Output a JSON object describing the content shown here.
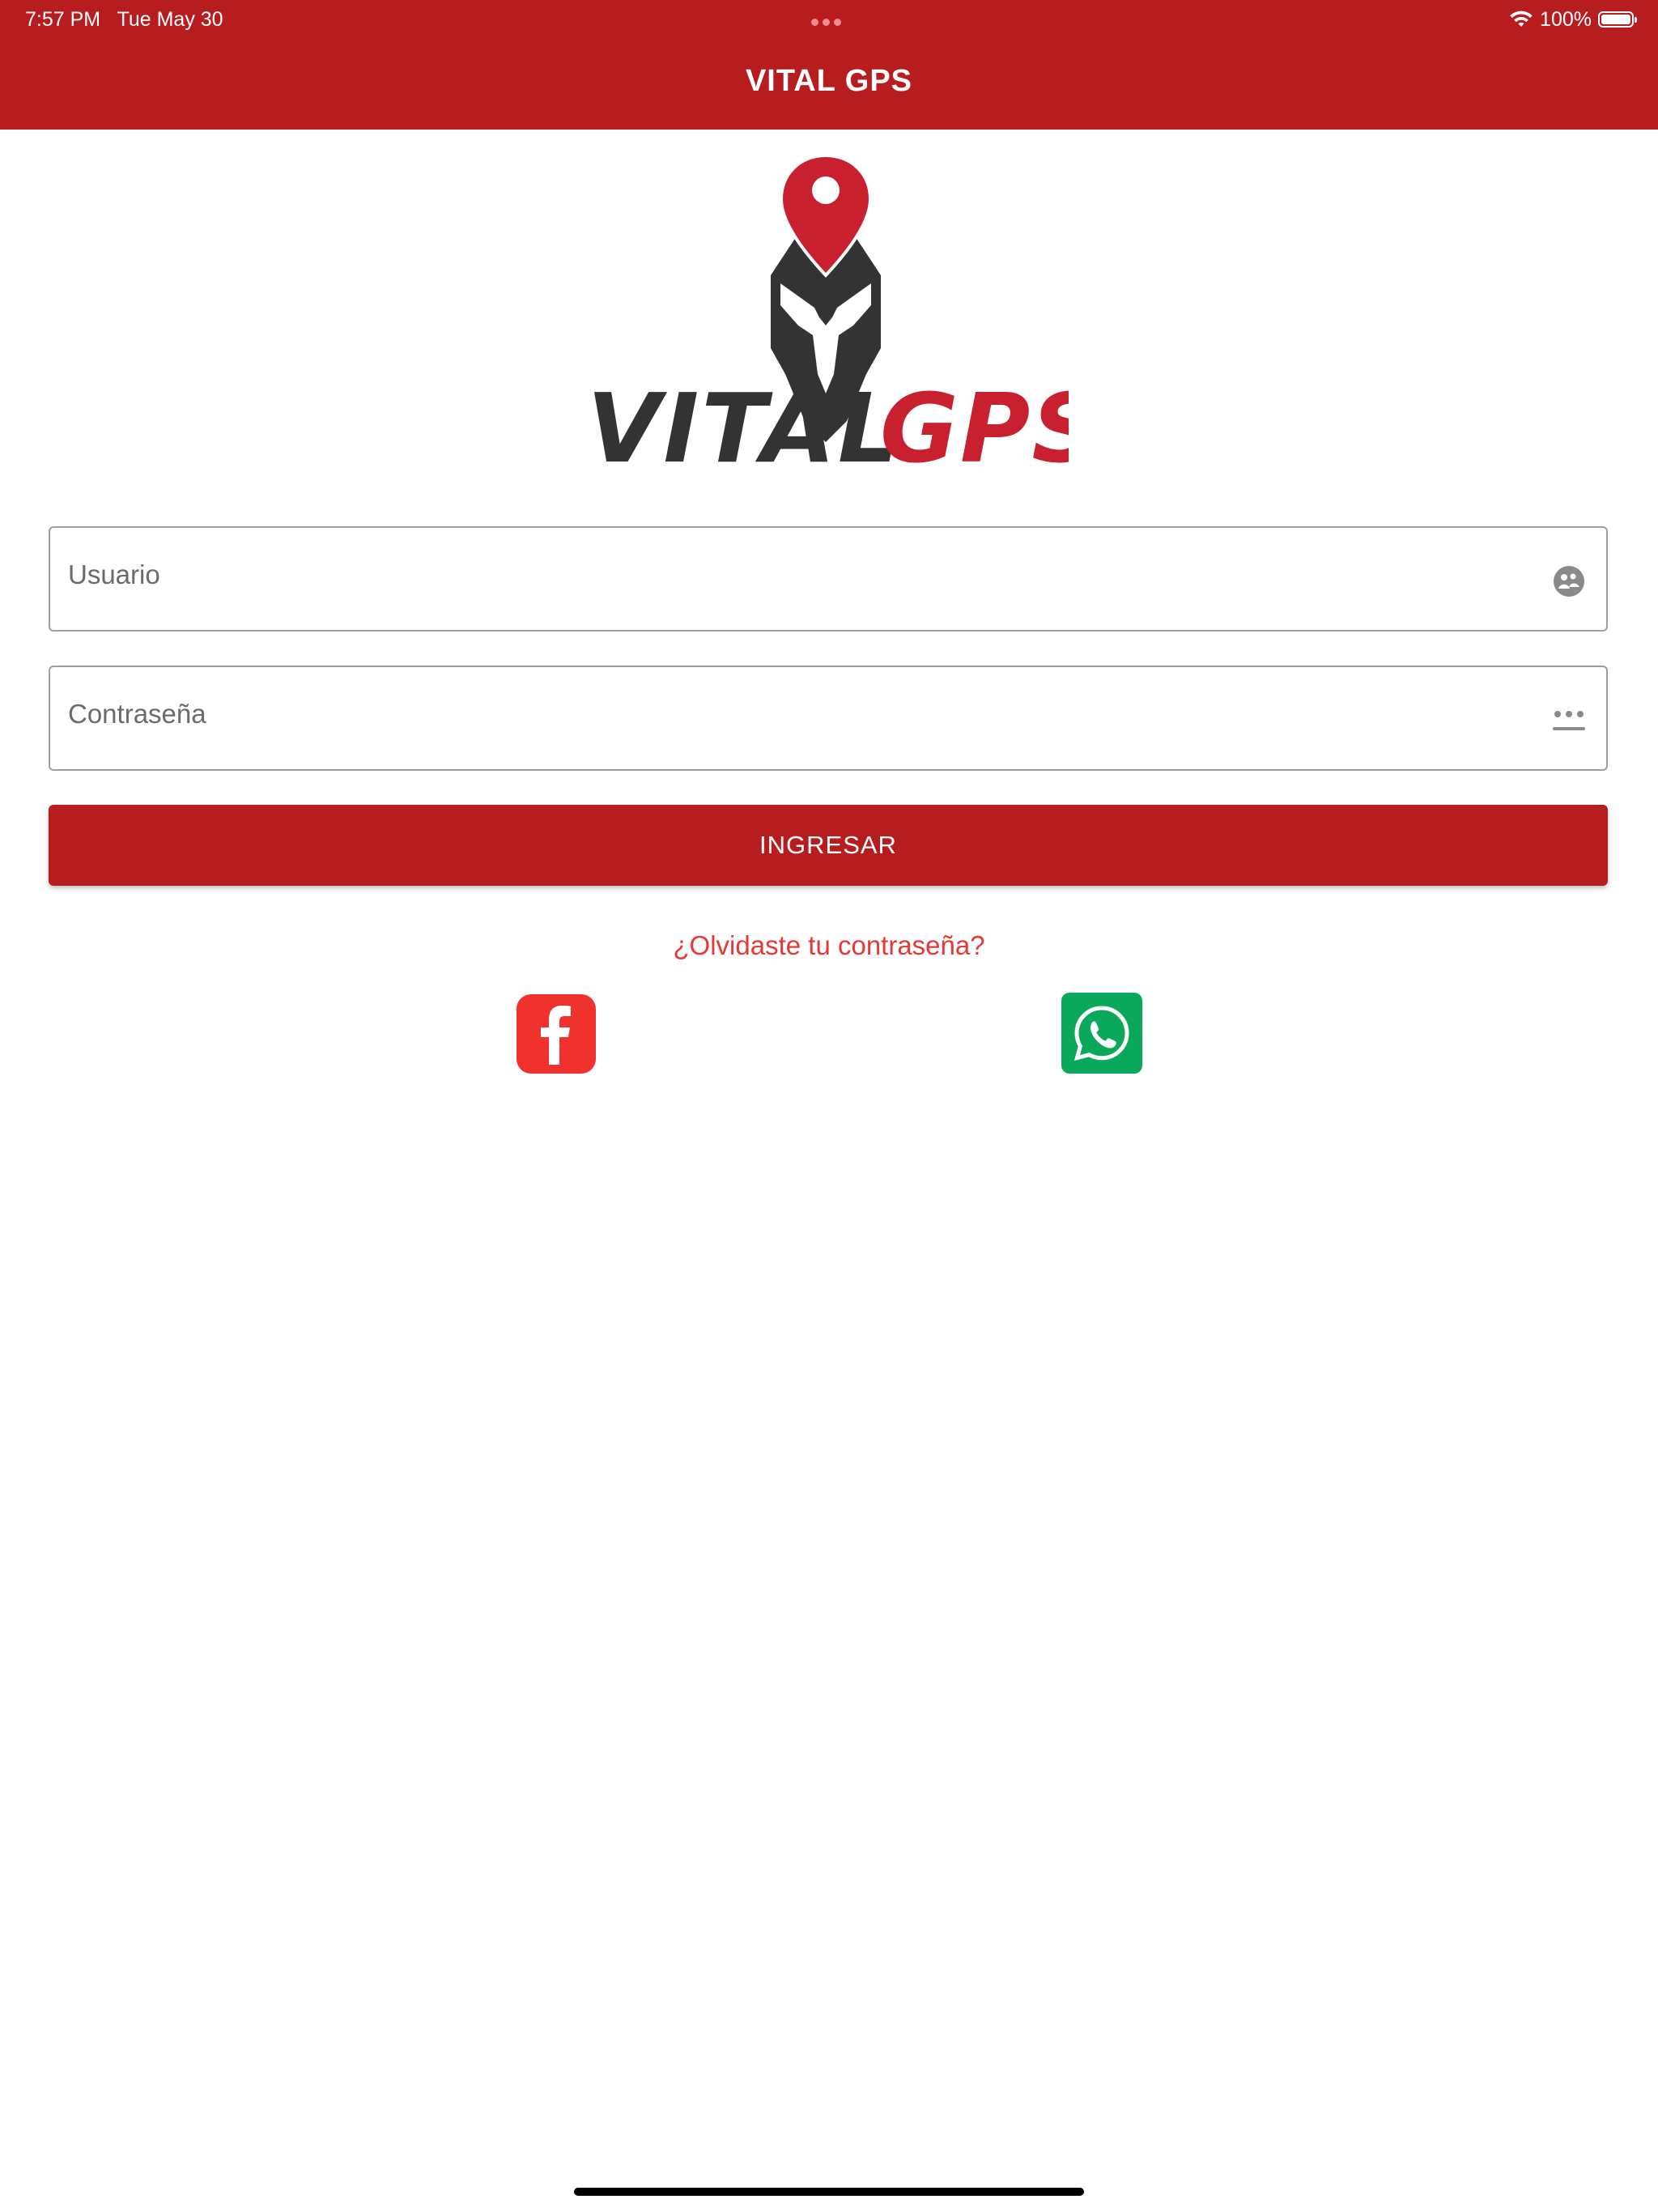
{
  "status_bar": {
    "time": "7:57 PM",
    "date": "Tue May 30",
    "battery": "100%"
  },
  "header": {
    "title": "VITAL GPS"
  },
  "logo": {
    "text_part1": "VITAL",
    "text_part2": "GPS"
  },
  "form": {
    "username_placeholder": "Usuario",
    "password_placeholder": "Contraseña",
    "login_label": "INGRESAR",
    "forgot_password": "¿Olvidaste tu contraseña?"
  },
  "colors": {
    "brand_red": "#b71c1e",
    "link_red": "#e53935",
    "facebook_red": "#f0322f",
    "whatsapp_green": "#0aa85a",
    "logo_dark": "#333333"
  },
  "icons": {
    "username": "user-icon",
    "password": "password-dots-icon",
    "facebook": "facebook-icon",
    "whatsapp": "whatsapp-icon"
  }
}
